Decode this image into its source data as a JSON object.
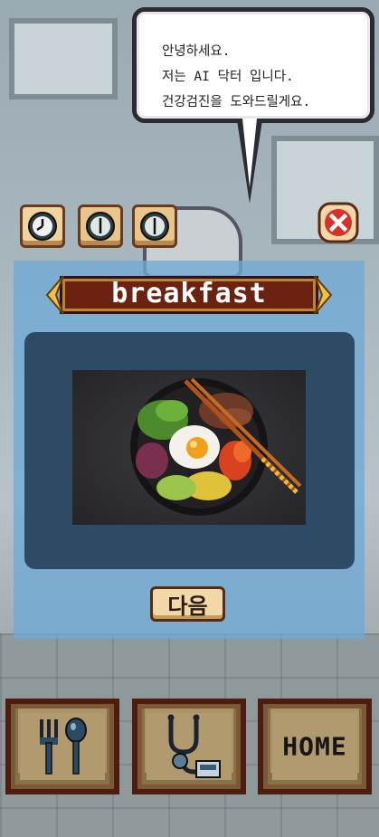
{
  "speech": {
    "line1": "안녕하세요.",
    "line2": "저는 AI 닥터 입니다.",
    "line3": "건강검진을 도와드릴게요."
  },
  "meal_tabs": [
    {
      "icon": "clock-icon",
      "active": true
    },
    {
      "icon": "clock-icon",
      "active": false
    },
    {
      "icon": "clock-icon",
      "active": false
    }
  ],
  "meal": {
    "title": "breakfast",
    "image_icon": "bibimbap-bowl-image"
  },
  "actions": {
    "next_label": "다음",
    "close_icon": "close-icon"
  },
  "bottom_nav": {
    "food_icon": "fork-spoon-icon",
    "checkup_icon": "stethoscope-icon",
    "home_label": "HOME"
  },
  "colors": {
    "panel": "#6eaad6",
    "banner": "#6b2210",
    "button_bg": "#f1d8a6"
  }
}
